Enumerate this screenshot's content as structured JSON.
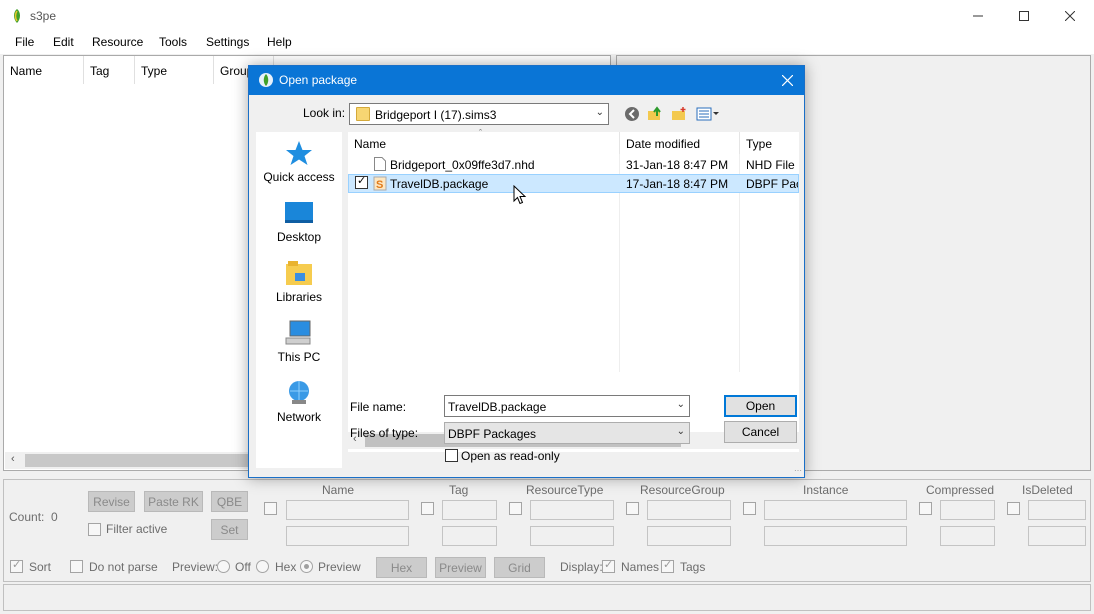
{
  "app": {
    "title": "s3pe",
    "menu": [
      "File",
      "Edit",
      "Resource",
      "Tools",
      "Settings",
      "Help"
    ],
    "columns": [
      "Name",
      "Tag",
      "Type",
      "Group"
    ]
  },
  "bottom_panel": {
    "count_label": "Count:",
    "count_value": "0",
    "buttons": {
      "revise": "Revise",
      "paste_rk": "Paste RK",
      "qbe": "QBE",
      "set": "Set",
      "hex": "Hex",
      "preview": "Preview",
      "grid": "Grid"
    },
    "filter_active": "Filter active",
    "fields": [
      "Name",
      "Tag",
      "ResourceType",
      "ResourceGroup",
      "Instance",
      "Compressed",
      "IsDeleted"
    ],
    "sort": "Sort",
    "do_not_parse": "Do not parse",
    "preview_label": "Preview:",
    "preview_options": [
      "Off",
      "Hex",
      "Preview"
    ],
    "display_label": "Display:",
    "display_names": "Names",
    "display_tags": "Tags"
  },
  "dialog": {
    "title": "Open package",
    "look_in_label": "Look in:",
    "look_in_value": "Bridgeport I (17).sims3",
    "places": [
      "Quick access",
      "Desktop",
      "Libraries",
      "This PC",
      "Network"
    ],
    "columns": {
      "name": "Name",
      "date": "Date modified",
      "type": "Type"
    },
    "files": [
      {
        "name": "Bridgeport_0x09ffe3d7.nhd",
        "date": "31-Jan-18 8:47 PM",
        "type": "NHD File"
      },
      {
        "name": "TravelDB.package",
        "date": "17-Jan-18 8:47 PM",
        "type": "DBPF Pacl"
      }
    ],
    "file_name_label": "File name:",
    "file_name_value": "TravelDB.package",
    "files_of_type_label": "Files of type:",
    "files_of_type_value": "DBPF Packages",
    "open_button": "Open",
    "cancel_button": "Cancel",
    "read_only_label": "Open as read-only"
  }
}
